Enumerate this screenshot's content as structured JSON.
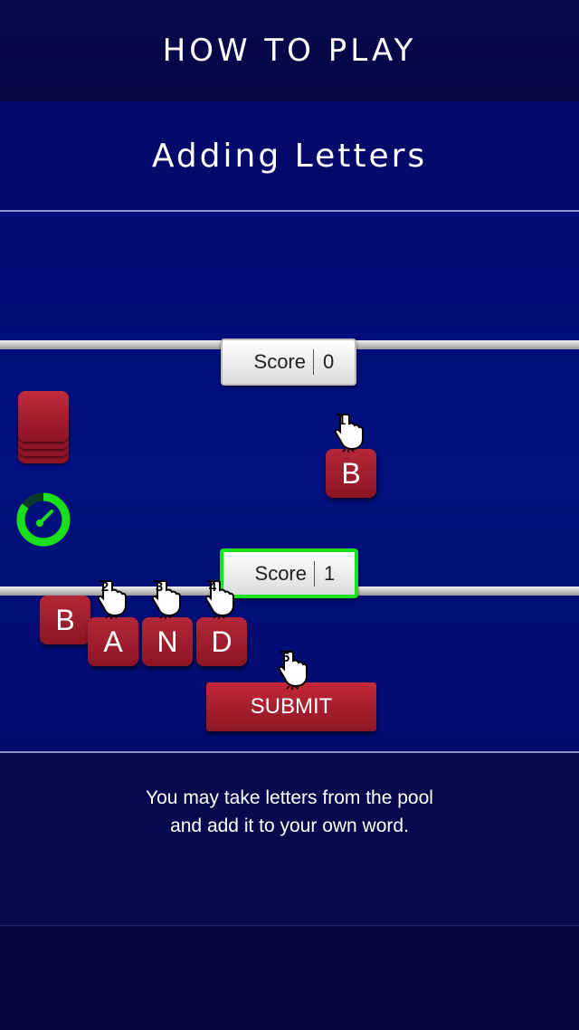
{
  "header": {
    "title": "HOW TO PLAY"
  },
  "section": {
    "title": "Adding Letters"
  },
  "opponent": {
    "score_label": "Score",
    "score_value": "0"
  },
  "player": {
    "score_label": "Score",
    "score_value": "1"
  },
  "pool": {
    "tiles": [
      "B"
    ]
  },
  "word": {
    "tiles": [
      "B",
      "A",
      "N",
      "D"
    ]
  },
  "steps": [
    "1",
    "2",
    "3",
    "4",
    "5"
  ],
  "submit": {
    "label": "SUBMIT"
  },
  "instructions": {
    "line1": "You may take letters from the pool",
    "line2": "and add it to your own word."
  },
  "timer": {
    "progress": 0.85
  },
  "colors": {
    "background": "#06084a",
    "board": "#03107e",
    "tile": "#a61d2f",
    "active_score_border": "#19e019",
    "timer": "#19e019"
  },
  "icons": {
    "pointer": "pointing-hand-icon",
    "timer": "stopwatch-icon",
    "deck": "tile-stack-icon"
  }
}
